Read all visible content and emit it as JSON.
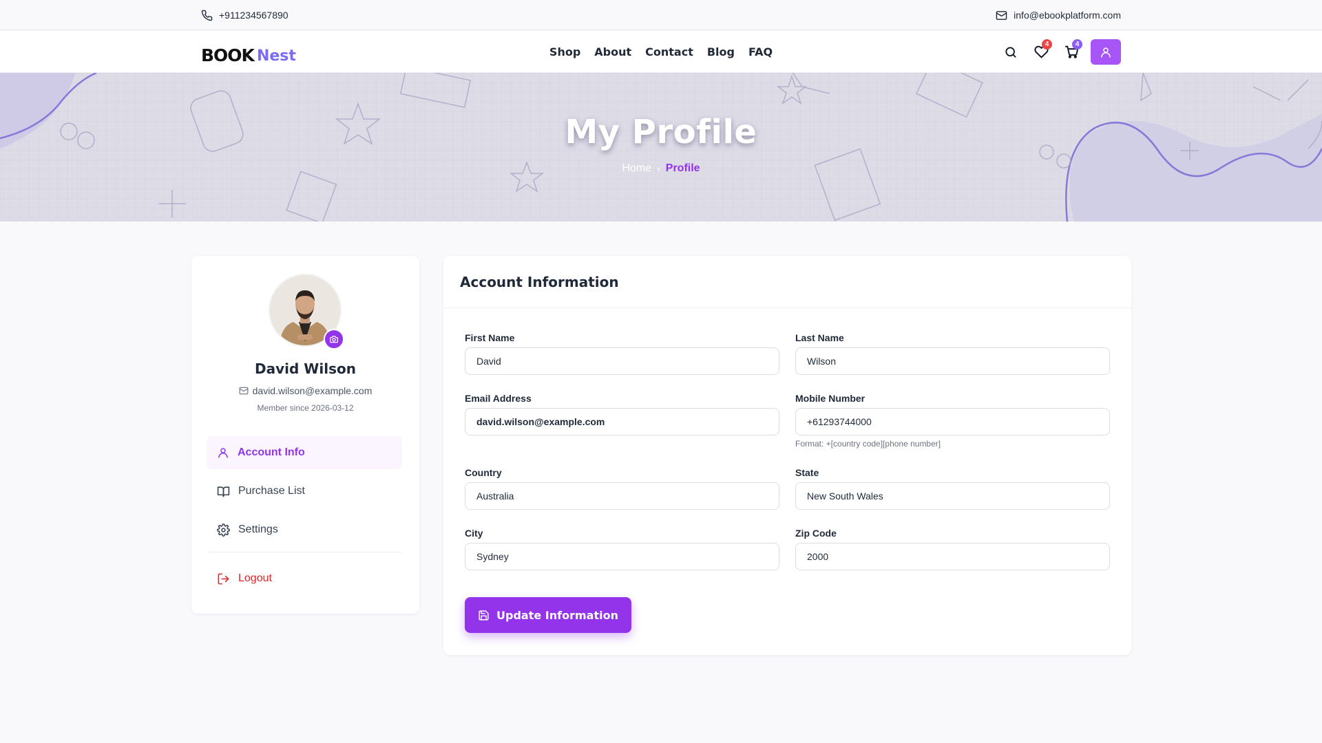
{
  "topbar": {
    "phone": "+911234567890",
    "email": "info@ebookplatform.com"
  },
  "brand": {
    "logo_part1": "BOOK",
    "logo_part2": "Nest",
    "accent_color": "#9333ea"
  },
  "nav": {
    "items": [
      {
        "label": "Shop"
      },
      {
        "label": "About"
      },
      {
        "label": "Contact"
      },
      {
        "label": "Blog"
      },
      {
        "label": "FAQ"
      }
    ],
    "wishlist_count": "4",
    "cart_count": "4",
    "icons": [
      "search-icon",
      "heart-icon",
      "cart-icon",
      "user-icon"
    ]
  },
  "hero": {
    "title": "My Profile",
    "breadcrumb_home": "Home",
    "breadcrumb_current": "Profile"
  },
  "profile": {
    "name": "David Wilson",
    "email": "david.wilson@example.com",
    "member_since": "Member since 2026-03-12"
  },
  "sidebar": {
    "items": [
      {
        "label": "Account Info",
        "icon": "user-icon",
        "active": true
      },
      {
        "label": "Purchase List",
        "icon": "book-icon"
      },
      {
        "label": "Settings",
        "icon": "gear-icon"
      }
    ],
    "logout": "Logout"
  },
  "form": {
    "title": "Account Information",
    "first_name": {
      "label": "First Name",
      "value": "David"
    },
    "last_name": {
      "label": "Last Name",
      "value": "Wilson"
    },
    "email": {
      "label": "Email Address",
      "value": "david.wilson@example.com"
    },
    "mobile": {
      "label": "Mobile Number",
      "value": "+61293744000",
      "hint": "Format: +[country code][phone number]"
    },
    "country": {
      "label": "Country",
      "value": "Australia"
    },
    "state": {
      "label": "State",
      "value": "New South Wales"
    },
    "city": {
      "label": "City",
      "value": "Sydney"
    },
    "zip": {
      "label": "Zip Code",
      "value": "2000"
    },
    "submit_label": "Update Information"
  }
}
